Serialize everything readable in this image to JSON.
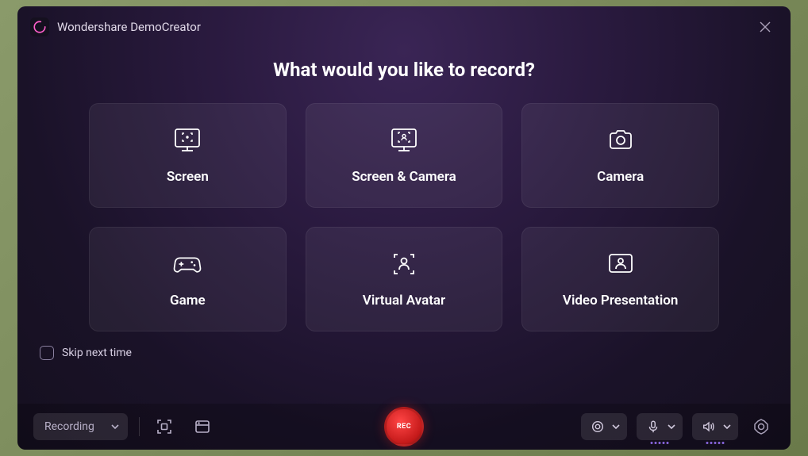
{
  "app": {
    "title": "Wondershare DemoCreator"
  },
  "heading": "What would you like to record?",
  "cards": [
    {
      "label": "Screen"
    },
    {
      "label": "Screen & Camera"
    },
    {
      "label": "Camera"
    },
    {
      "label": "Game"
    },
    {
      "label": "Virtual Avatar"
    },
    {
      "label": "Video Presentation"
    }
  ],
  "skip": {
    "label": "Skip next time"
  },
  "bottombar": {
    "mode": "Recording",
    "rec": "REC"
  }
}
